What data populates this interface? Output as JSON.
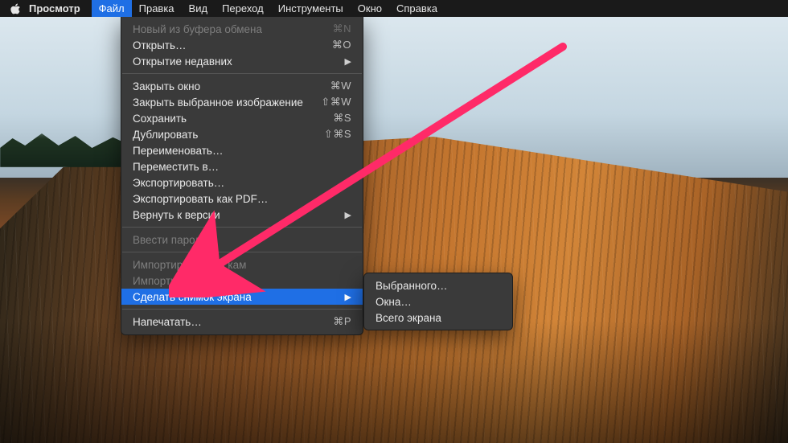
{
  "menubar": {
    "app_name": "Просмотр",
    "items": [
      {
        "label": "Файл",
        "active": true
      },
      {
        "label": "Правка"
      },
      {
        "label": "Вид"
      },
      {
        "label": "Переход"
      },
      {
        "label": "Инструменты"
      },
      {
        "label": "Окно"
      },
      {
        "label": "Справка"
      }
    ]
  },
  "dropdown": {
    "groups": [
      [
        {
          "label": "Новый из буфера обмена",
          "shortcut": "⌘N",
          "disabled": true
        },
        {
          "label": "Открыть…",
          "shortcut": "⌘O"
        },
        {
          "label": "Открытие недавних",
          "submenu": true
        }
      ],
      [
        {
          "label": "Закрыть окно",
          "shortcut": "⌘W"
        },
        {
          "label": "Закрыть выбранное изображение",
          "shortcut": "⇧⌘W"
        },
        {
          "label": "Сохранить",
          "shortcut": "⌘S"
        },
        {
          "label": "Дублировать",
          "shortcut": "⇧⌘S"
        },
        {
          "label": "Переименовать…"
        },
        {
          "label": "Переместить в…"
        },
        {
          "label": "Экспортировать…"
        },
        {
          "label": "Экспортировать как PDF…"
        },
        {
          "label": "Вернуть к версии",
          "submenu": true
        }
      ],
      [
        {
          "label": "Ввести пароль…",
          "disabled": true
        }
      ],
      [
        {
          "label": "Импортировать из кам",
          "disabled": true
        },
        {
          "label": "Импортировать со ска",
          "disabled": true
        },
        {
          "label": "Сделать снимок экрана",
          "submenu": true,
          "highlight": true
        }
      ],
      [
        {
          "label": "Напечатать…",
          "shortcut": "⌘P"
        }
      ]
    ]
  },
  "submenu": {
    "items": [
      {
        "label": "Выбранного…"
      },
      {
        "label": "Окна…"
      },
      {
        "label": "Всего экрана"
      }
    ]
  },
  "annotation": {
    "color": "#ff2a68"
  }
}
